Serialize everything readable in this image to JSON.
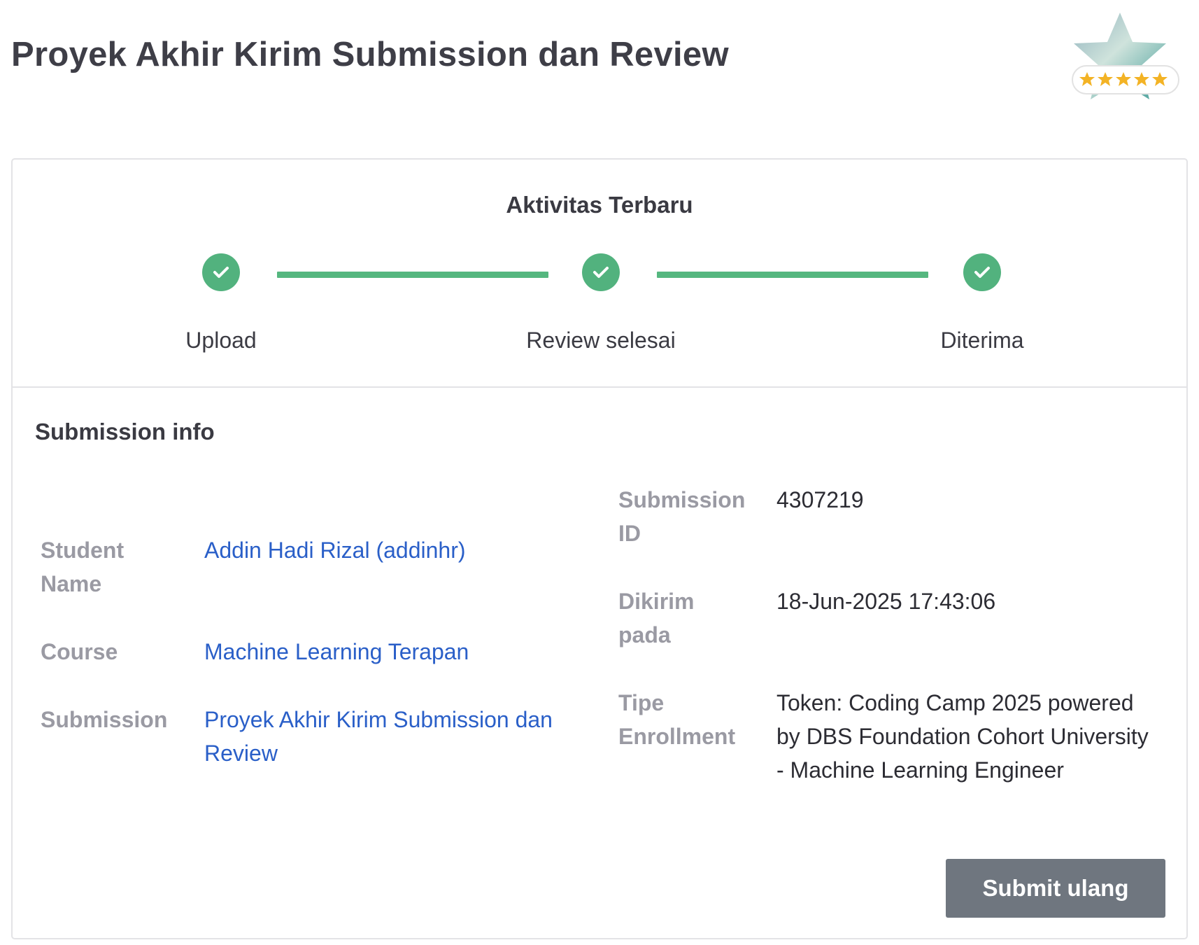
{
  "header": {
    "title": "Proyek Akhir Kirim Submission dan Review",
    "badge_icon": "star-rating-badge-icon",
    "badge_rating": 5
  },
  "activity": {
    "title": "Aktivitas Terbaru",
    "steps": [
      {
        "label": "Upload",
        "status": "done"
      },
      {
        "label": "Review selesai",
        "status": "done"
      },
      {
        "label": "Diterima",
        "status": "done"
      }
    ],
    "accent_color": "#52b27e"
  },
  "submission_info": {
    "title": "Submission info",
    "student_name_label": "Student Name",
    "student_name_value": "Addin Hadi Rizal (addinhr)",
    "course_label": "Course",
    "course_value": "Machine Learning Terapan",
    "submission_label": "Submission",
    "submission_value": "Proyek Akhir Kirim Submission dan Review",
    "submission_id_label": "Submission ID",
    "submission_id_value": "4307219",
    "sent_label": "Dikirim pada",
    "sent_value": "18-Jun-2025 17:43:06",
    "enrollment_label": "Tipe Enrollment",
    "enrollment_value": "Token: Coding Camp 2025 powered by DBS Foundation Cohort University - Machine Learning Engineer",
    "link_color": "#2a5fc8"
  },
  "actions": {
    "resubmit_label": "Submit ulang",
    "button_color": "#6f767f"
  }
}
